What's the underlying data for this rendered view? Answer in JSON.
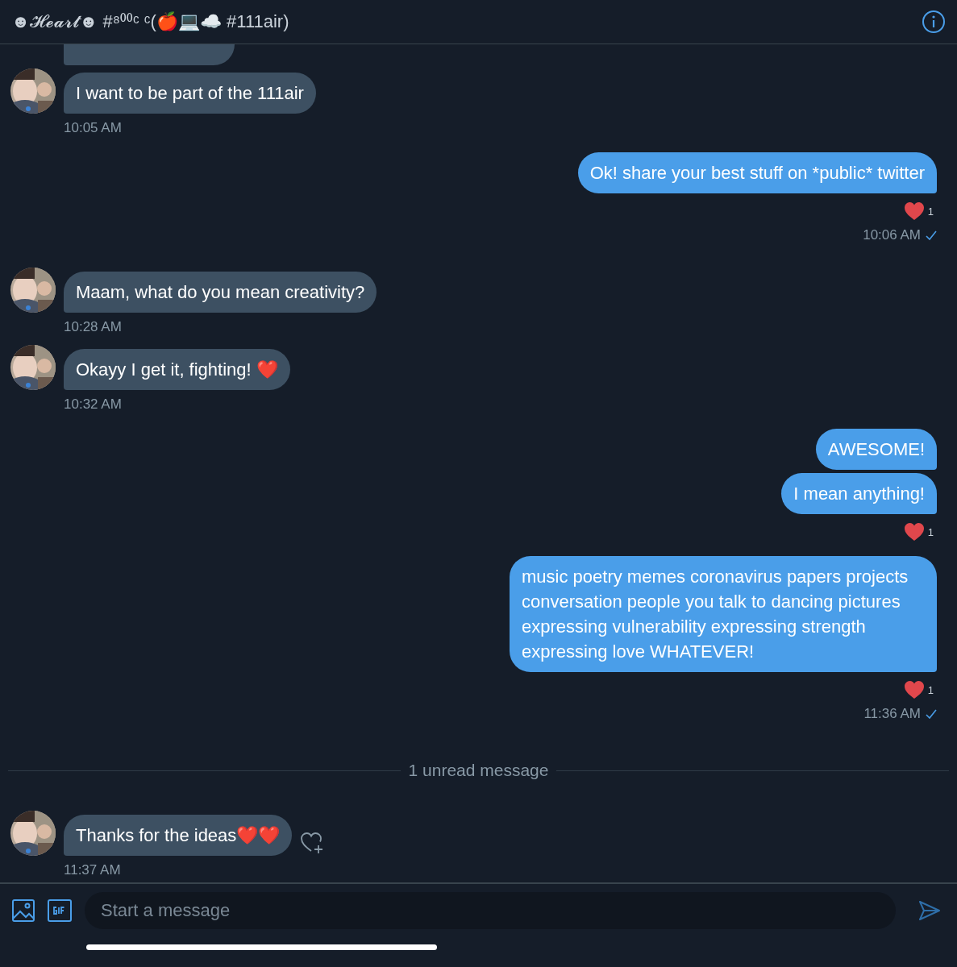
{
  "header": {
    "title": "☻𝓗𝓮𝓪𝓻𝓽☻ #⁸⁰⁰ᶜ ᶜ(🍎💻☁️ #111air)"
  },
  "messages": [
    {
      "kind": "received",
      "partial_bubble": true,
      "bubbles": [
        "I want to be part of the 111air"
      ],
      "time": "10:05 AM"
    },
    {
      "kind": "sent",
      "bubbles": [
        "Ok! share your best stuff on *public* twitter"
      ],
      "reaction": "1",
      "time": "10:06 AM",
      "read": true
    },
    {
      "kind": "received",
      "bubbles": [
        "Maam, what do you mean creativity?"
      ],
      "time": "10:28 AM"
    },
    {
      "kind": "received",
      "bubbles": [
        "Okayy I get it, fighting! ❤️"
      ],
      "time": "10:32 AM"
    },
    {
      "kind": "sent",
      "bubbles": [
        "AWESOME!",
        "I mean anything!"
      ],
      "reaction": "1"
    },
    {
      "kind": "sent",
      "bubbles": [
        "music poetry memes coronavirus papers projects conversation people you talk to dancing pictures expressing vulnerability expressing strength expressing love WHATEVER!"
      ],
      "reaction": "1",
      "time": "11:36 AM",
      "read": true
    },
    {
      "kind": "divider",
      "text": "1 unread message"
    },
    {
      "kind": "received",
      "bubbles": [
        "Thanks for the ideas❤️❤️"
      ],
      "time": "11:37 AM",
      "add_reaction": true
    }
  ],
  "composer": {
    "placeholder": "Start a message"
  }
}
